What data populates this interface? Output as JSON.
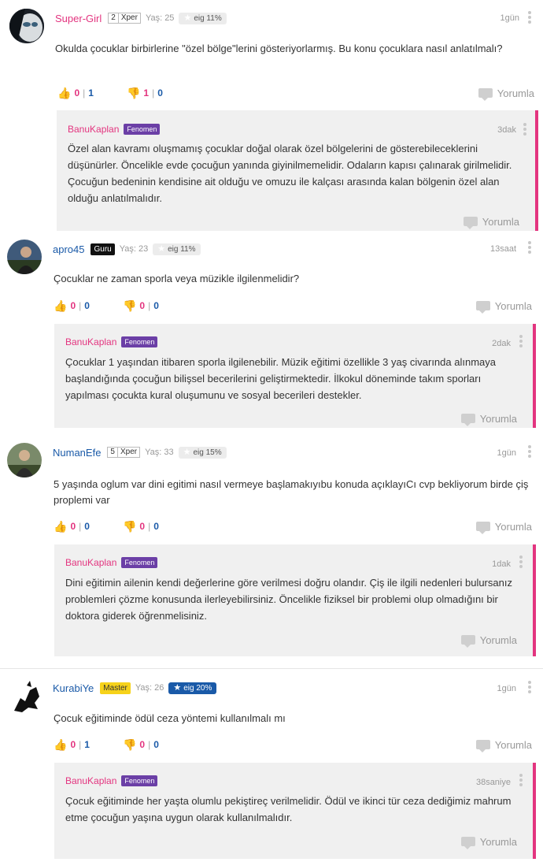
{
  "comments": [
    {
      "username": "Super-Girl",
      "level_num": "2",
      "level_text": "Xper",
      "badge": "",
      "age": "Yaş: 25",
      "eig": "eig 11%",
      "time": "1gün",
      "text": "Okulda çocuklar birbirlerine \"özel bölge\"lerini gösteriyorlarmış. Bu konu çocuklara nasıl anlatılmalı?",
      "likes_a": "0",
      "likes_b": "1",
      "dislikes_a": "1",
      "dislikes_b": "0",
      "reply_label": "Yorumla",
      "answer": {
        "username": "BanuKaplan",
        "badge": "Fenomen",
        "time": "3dak",
        "text": "Özel alan kavramı oluşmamış çocuklar doğal olarak özel bölgelerini de gösterebileceklerini düşünürler. Öncelikle evde çocuğun yanında giyinilmemelidir. Odaların kapısı çalınarak girilmelidir. Çocuğun bedeninin kendisine ait olduğu ve omuzu ile kalçası arasında kalan bölgenin özel alan olduğu anlatılmalıdır.",
        "reply_label": "Yorumla"
      }
    },
    {
      "username": "apro45",
      "level_num": "",
      "level_text": "",
      "badge": "Guru",
      "age": "Yaş: 23",
      "eig": "eig 11%",
      "time": "13saat",
      "text": "Çocuklar ne zaman sporla veya müzikle ilgilenmelidir?",
      "likes_a": "0",
      "likes_b": "0",
      "dislikes_a": "0",
      "dislikes_b": "0",
      "reply_label": "Yorumla",
      "answer": {
        "username": "BanuKaplan",
        "badge": "Fenomen",
        "time": "2dak",
        "text": "Çocuklar 1 yaşından itibaren sporla ilgilenebilir. Müzik eğitimi özellikle 3 yaş civarında alınmaya başlandığında çocuğun bilişsel becerilerini geliştirmektedir. İlkokul döneminde takım sporları yapılması çocukta kural oluşumunu ve sosyal becerileri destekler.",
        "reply_label": "Yorumla"
      }
    },
    {
      "username": "NumanEfe",
      "level_num": "5",
      "level_text": "Xper",
      "badge": "",
      "age": "Yaş: 33",
      "eig": "eig 15%",
      "time": "1gün",
      "text": "5 yaşında oglum var dini egitimi nasıl vermeye başlamakıyıbu konuda açıklayıCı cvp bekliyorum birde çiş proplemi var",
      "likes_a": "0",
      "likes_b": "0",
      "dislikes_a": "0",
      "dislikes_b": "0",
      "reply_label": "Yorumla",
      "answer": {
        "username": "BanuKaplan",
        "badge": "Fenomen",
        "time": "1dak",
        "text": "Dini eğitimin ailenin kendi değerlerine göre verilmesi doğru olandır. Çiş ile ilgili nedenleri bulursanız problemleri çözme konusunda ilerleyebilirsiniz. Öncelikle fiziksel bir problemi olup olmadığını bir doktora giderek öğrenmelisiniz.",
        "reply_label": "Yorumla"
      }
    },
    {
      "username": "KurabiYe",
      "level_num": "",
      "level_text": "",
      "badge": "Master",
      "age": "Yaş: 26",
      "eig": "eig 20%",
      "time": "1gün",
      "text": "Çocuk eğitiminde ödül ceza yöntemi kullanılmalı mı",
      "likes_a": "0",
      "likes_b": "1",
      "dislikes_a": "0",
      "dislikes_b": "0",
      "reply_label": "Yorumla",
      "answer": {
        "username": "BanuKaplan",
        "badge": "Fenomen",
        "time": "38saniye",
        "text": "Çocuk eğitiminde her yaşta olumlu pekiştireç verilmelidir. Ödül ve ikinci tür ceza dediğimiz mahrum etme çocuğun yaşına uygun olarak kullanılmalıdır.",
        "reply_label": "Yorumla"
      }
    }
  ]
}
